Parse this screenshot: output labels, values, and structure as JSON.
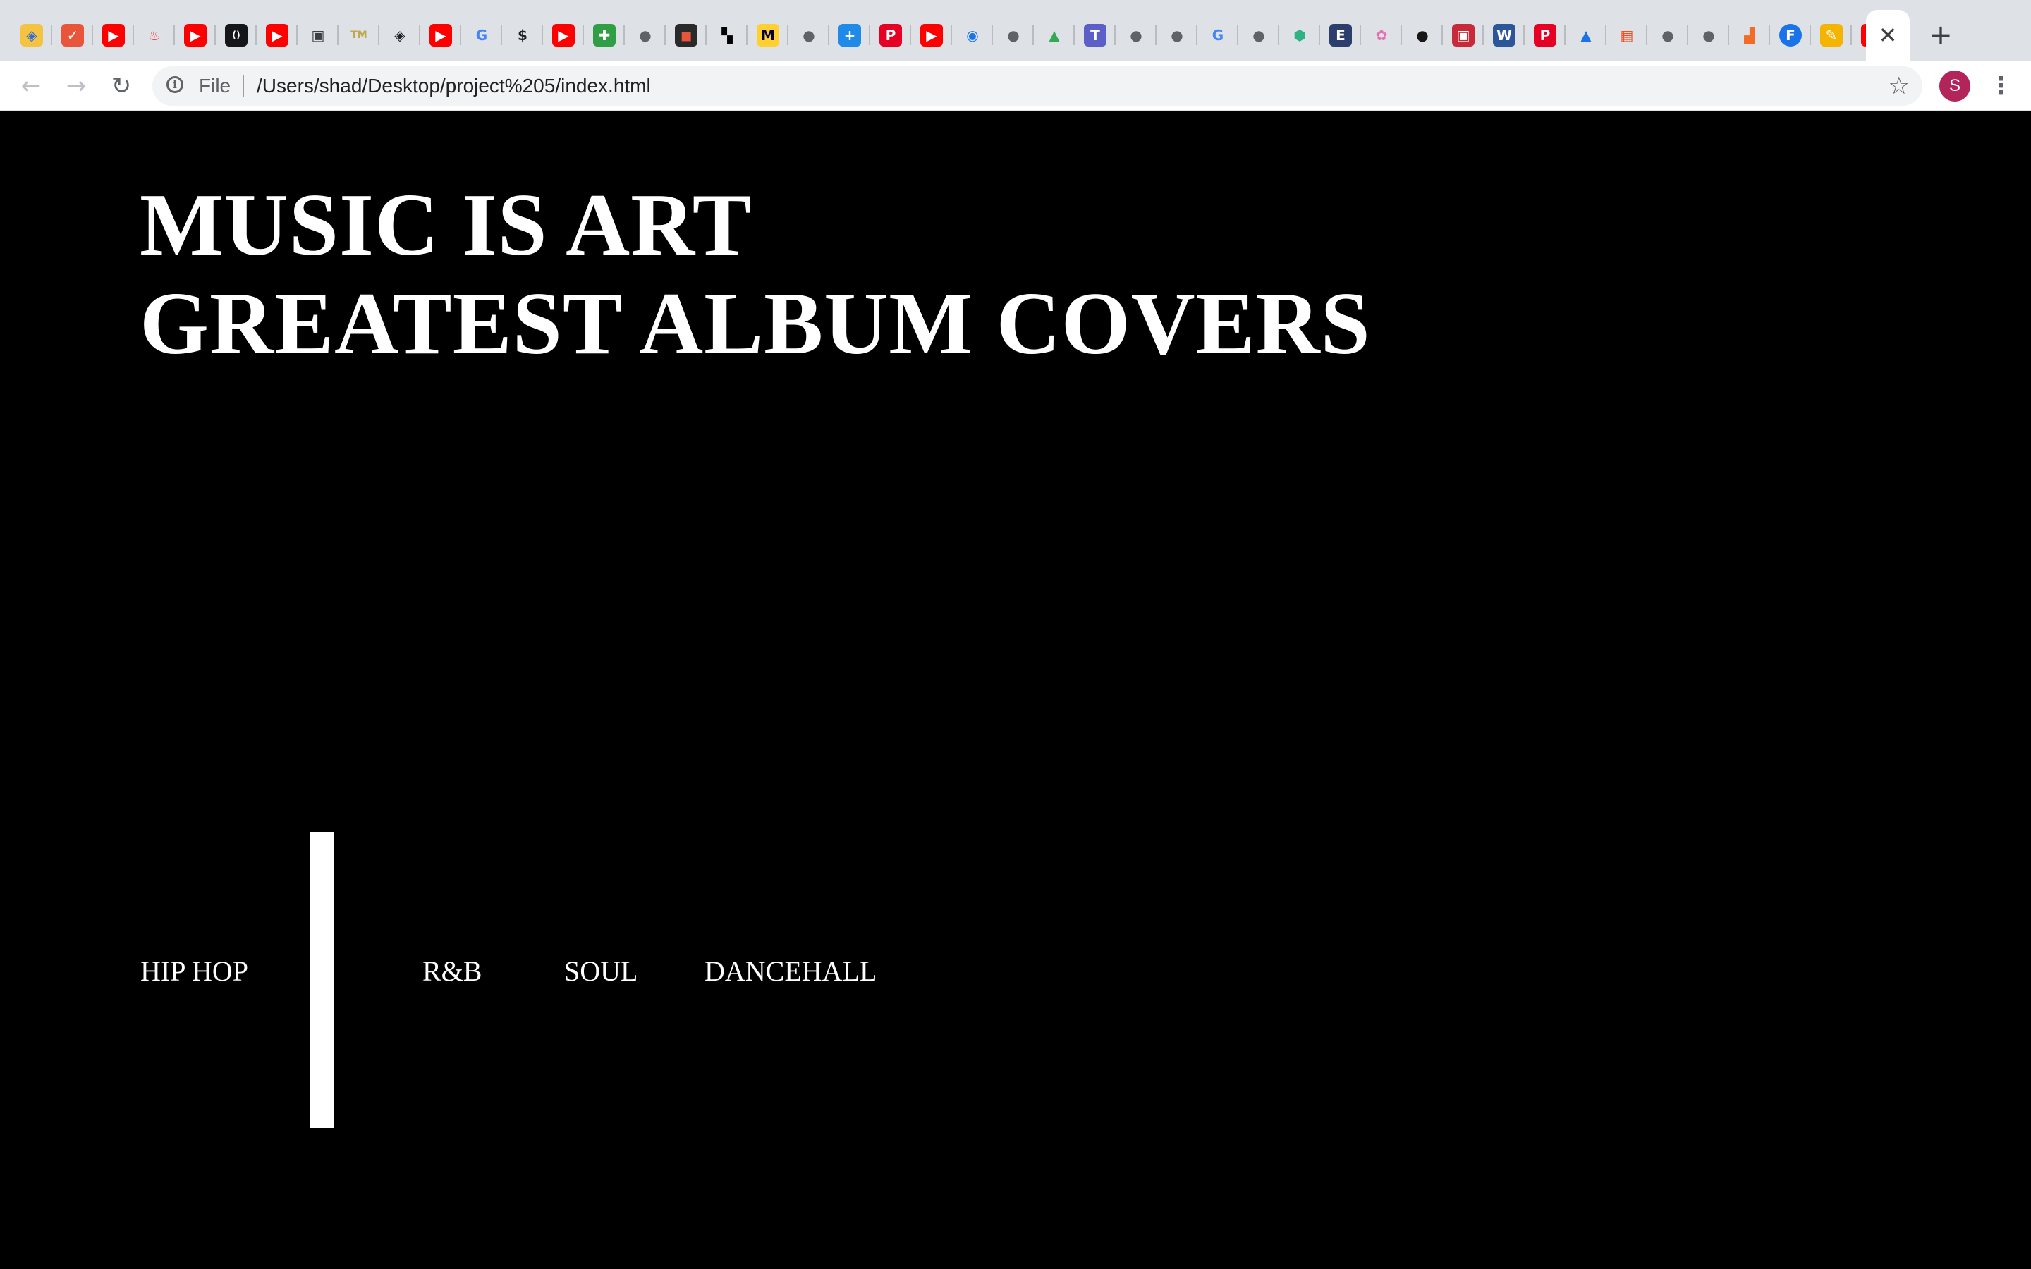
{
  "browser": {
    "tabs": [
      {
        "icon": "colorful-shield-icon",
        "glyph": "◈",
        "bg": "#f5c342",
        "fg": "#2f6bd8"
      },
      {
        "icon": "checkmark-circle-icon",
        "glyph": "✓",
        "bg": "#e8553b",
        "fg": "#ffffff"
      },
      {
        "icon": "youtube-icon",
        "glyph": "▶",
        "bg": "#ff0000",
        "fg": "#ffffff"
      },
      {
        "icon": "flame-icon",
        "glyph": "♨",
        "bg": "#dee1e6",
        "fg": "#fe3c3c"
      },
      {
        "icon": "youtube-icon",
        "glyph": "▶",
        "bg": "#ff0000",
        "fg": "#ffffff"
      },
      {
        "icon": "code-brackets-icon",
        "glyph": "⟨⟩",
        "bg": "#14161a",
        "fg": "#ffffff"
      },
      {
        "icon": "youtube-icon",
        "glyph": "▶",
        "bg": "#ff0000",
        "fg": "#ffffff"
      },
      {
        "icon": "document-icon",
        "glyph": "▣",
        "bg": "#dee1e6",
        "fg": "#3c4043"
      },
      {
        "icon": "tm-logo-icon",
        "glyph": "TM",
        "bg": "#dee1e6",
        "fg": "#c0a84a"
      },
      {
        "icon": "diamond-target-icon",
        "glyph": "◈",
        "bg": "#dee1e6",
        "fg": "#202124"
      },
      {
        "icon": "youtube-icon",
        "glyph": "▶",
        "bg": "#ff0000",
        "fg": "#ffffff"
      },
      {
        "icon": "google-icon",
        "glyph": "G",
        "bg": "#dee1e6",
        "fg": "#4285f4"
      },
      {
        "icon": "dollar-icon",
        "glyph": "$",
        "bg": "#dee1e6",
        "fg": "#202124"
      },
      {
        "icon": "youtube-icon",
        "glyph": "▶",
        "bg": "#ff0000",
        "fg": "#ffffff"
      },
      {
        "icon": "green-plus-icon",
        "glyph": "✚",
        "bg": "#2f9e44",
        "fg": "#ffffff"
      },
      {
        "icon": "globe-icon",
        "glyph": "●",
        "bg": "#dee1e6",
        "fg": "#5f6368"
      },
      {
        "icon": "colorful-square-icon",
        "glyph": "◼",
        "bg": "#2a2a2a",
        "fg": "#e8553b"
      },
      {
        "icon": "blocks-icon",
        "glyph": "▚",
        "bg": "#dee1e6",
        "fg": "#000000"
      },
      {
        "icon": "miro-icon",
        "glyph": "M",
        "bg": "#ffd02f",
        "fg": "#050038"
      },
      {
        "icon": "globe-icon",
        "glyph": "●",
        "bg": "#dee1e6",
        "fg": "#5f6368"
      },
      {
        "icon": "blue-plus-icon",
        "glyph": "+",
        "bg": "#1f8ae8",
        "fg": "#ffffff"
      },
      {
        "icon": "pinterest-icon",
        "glyph": "P",
        "bg": "#e60023",
        "fg": "#ffffff"
      },
      {
        "icon": "youtube-icon",
        "glyph": "▶",
        "bg": "#ff0000",
        "fg": "#ffffff"
      },
      {
        "icon": "blue-ring-icon",
        "glyph": "◉",
        "bg": "#dee1e6",
        "fg": "#1a73e8"
      },
      {
        "icon": "globe-icon",
        "glyph": "●",
        "bg": "#dee1e6",
        "fg": "#5f6368"
      },
      {
        "icon": "google-drive-icon",
        "glyph": "▲",
        "bg": "#dee1e6",
        "fg": "#34a853"
      },
      {
        "icon": "teams-icon",
        "glyph": "T",
        "bg": "#5b5fc7",
        "fg": "#ffffff"
      },
      {
        "icon": "globe-icon",
        "glyph": "●",
        "bg": "#dee1e6",
        "fg": "#5f6368"
      },
      {
        "icon": "globe-icon",
        "glyph": "●",
        "bg": "#dee1e6",
        "fg": "#5f6368"
      },
      {
        "icon": "google-icon",
        "glyph": "G",
        "bg": "#dee1e6",
        "fg": "#4285f4"
      },
      {
        "icon": "globe-icon",
        "glyph": "●",
        "bg": "#dee1e6",
        "fg": "#5f6368"
      },
      {
        "icon": "green-shield-icon",
        "glyph": "⬢",
        "bg": "#dee1e6",
        "fg": "#2fb383"
      },
      {
        "icon": "e-logo-icon",
        "glyph": "E",
        "bg": "#2c3e6b",
        "fg": "#ffffff"
      },
      {
        "icon": "colorful-people-icon",
        "glyph": "✿",
        "bg": "#dee1e6",
        "fg": "#e26fb0"
      },
      {
        "icon": "github-icon",
        "glyph": "●",
        "bg": "#dee1e6",
        "fg": "#181717"
      },
      {
        "icon": "red-box-icon",
        "glyph": "▣",
        "bg": "#c92a3a",
        "fg": "#ffffff"
      },
      {
        "icon": "word-icon",
        "glyph": "W",
        "bg": "#2b579a",
        "fg": "#ffffff"
      },
      {
        "icon": "pinterest-icon",
        "glyph": "P",
        "bg": "#e60023",
        "fg": "#ffffff"
      },
      {
        "icon": "arrow-logo-icon",
        "glyph": "▲",
        "bg": "#dee1e6",
        "fg": "#1a73e8"
      },
      {
        "icon": "microsoft-icon",
        "glyph": "▦",
        "bg": "#dee1e6",
        "fg": "#f25022"
      },
      {
        "icon": "globe-icon",
        "glyph": "●",
        "bg": "#dee1e6",
        "fg": "#5f6368"
      },
      {
        "icon": "globe-icon",
        "glyph": "●",
        "bg": "#dee1e6",
        "fg": "#5f6368"
      },
      {
        "icon": "stairs-icon",
        "glyph": "▟",
        "bg": "#dee1e6",
        "fg": "#f26b27"
      },
      {
        "icon": "f-circle-icon",
        "glyph": "F",
        "bg": "#1a73e8",
        "fg": "#ffffff"
      },
      {
        "icon": "pencil-icon",
        "glyph": "✎",
        "bg": "#f4b400",
        "fg": "#ffffff"
      },
      {
        "icon": "youtube-icon",
        "glyph": "▶",
        "bg": "#ff0000",
        "fg": "#ffffff"
      }
    ],
    "active_tab_close": "✕",
    "new_tab": "+",
    "back": "←",
    "forward": "→",
    "reload": "↻",
    "info_glyph": "i",
    "url_scheme": "File",
    "url": "/Users/shad/Desktop/project%205/index.html",
    "star": "☆",
    "avatar_letter": "S",
    "menu": "⋮"
  },
  "page": {
    "title_line1": "MUSIC IS ART",
    "title_line2": "GREATEST ALBUM COVERS",
    "genres": [
      "HIP HOP",
      "R&B",
      "SOUL",
      "DANCEHALL"
    ]
  }
}
